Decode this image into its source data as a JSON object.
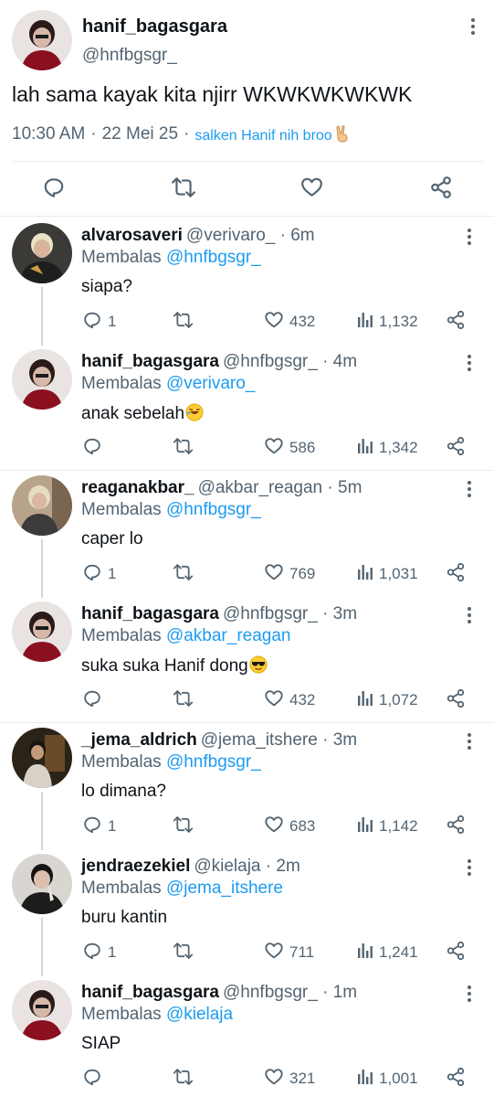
{
  "main": {
    "name": "hanif_bagasgara",
    "handle": "@hnfbgsgr_",
    "text": "lah sama kayak kita njirr WKWKWKWKWK",
    "time": "10:30 AM",
    "date": "22 Mei 25",
    "dot": "·",
    "source": "salken Hanif nih broo",
    "source_emoji": "victory-hand-emoji",
    "icons": [
      "reply-icon",
      "retweet-icon",
      "like-icon",
      "share-icon"
    ]
  },
  "replies": [
    {
      "name": "alvarosaveri",
      "handle": "@verivaro_ · 6m",
      "reply_prefix": "Membalas",
      "mention": "@hnfbgsgr_",
      "text": "siapa?",
      "emoji": "",
      "reply_count": "1",
      "likes": "432",
      "views": "1,132"
    },
    {
      "name": "hanif_bagasgara",
      "handle": "@hnfbgsgr_ · 4m",
      "reply_prefix": "Membalas",
      "mention": "@verivaro_",
      "text": "anak sebelah",
      "emoji": "rolling-laughing-emoji",
      "reply_count": "",
      "likes": "586",
      "views": "1,342"
    },
    {
      "name": "reaganakbar_",
      "handle": "@akbar_reagan · 5m",
      "reply_prefix": "Membalas",
      "mention": "@hnfbgsgr_",
      "text": "caper lo",
      "emoji": "",
      "reply_count": "1",
      "likes": "769",
      "views": "1,031"
    },
    {
      "name": "hanif_bagasgara",
      "handle": "@hnfbgsgr_ · 3m",
      "reply_prefix": "Membalas",
      "mention": "@akbar_reagan",
      "text": "suka suka Hanif dong",
      "emoji": "sunglasses-emoji",
      "reply_count": "",
      "likes": "432",
      "views": "1,072"
    },
    {
      "name": "_jema_aldrich",
      "handle": "@jema_itshere · 3m",
      "reply_prefix": "Membalas",
      "mention": "@hnfbgsgr_",
      "text": "lo dimana?",
      "emoji": "",
      "reply_count": "1",
      "likes": "683",
      "views": "1,142"
    },
    {
      "name": "jendraezekiel",
      "handle": "@kielaja · 2m",
      "reply_prefix": "Membalas",
      "mention": "@jema_itshere",
      "text": "buru kantin",
      "emoji": "",
      "reply_count": "1",
      "likes": "711",
      "views": "1,241"
    },
    {
      "name": "hanif_bagasgara",
      "handle": "@hnfbgsgr_ · 1m",
      "reply_prefix": "Membalas",
      "mention": "@kielaja",
      "text": "SIAP",
      "emoji": "",
      "reply_count": "",
      "likes": "321",
      "views": "1,001"
    }
  ],
  "colors": {
    "accent": "#1d9bf0",
    "muted": "#536471",
    "text": "#0f1419",
    "divider": "#e6ecf0"
  }
}
